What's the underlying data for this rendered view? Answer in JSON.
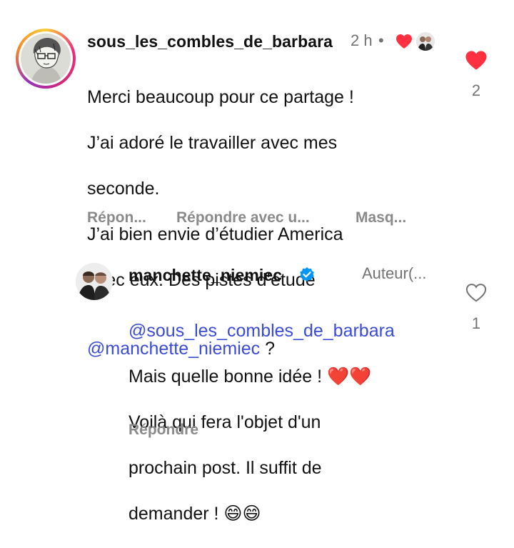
{
  "comment1": {
    "username": "sous_les_combles_de_barbara",
    "time": "2 h",
    "dot": "•",
    "lines": [
      "Merci beaucoup pour ce partage !",
      "J’ai adoré le travailler avec mes",
      "seconde.",
      "J’ai bien envie d’étudier America",
      "avec eux. Des pistes d’étude"
    ],
    "mention": "manchette_niemiec",
    "mention_suffix": " ?",
    "actions": [
      "Répon...",
      "Répondre avec u...",
      "Masq..."
    ],
    "like_count": "2",
    "liked": true
  },
  "comment2": {
    "username": "manchette_niemiec",
    "tag": "Auteur(...",
    "mention": "sous_les_combles_de_barbara",
    "lines": [
      "Mais quelle bonne idée !",
      "Voilà qui fera l'objet d'un",
      "prochain post. Il suffit de",
      "demander !"
    ],
    "emoji_hearts": "❤️❤️",
    "emoji_smiles": "😄😄",
    "action": "Répondre",
    "like_count": "1",
    "liked": false
  },
  "colors": {
    "like_red": "#ff3040",
    "mention_blue": "#3a4bd8",
    "verified_blue": "#0095f6"
  }
}
